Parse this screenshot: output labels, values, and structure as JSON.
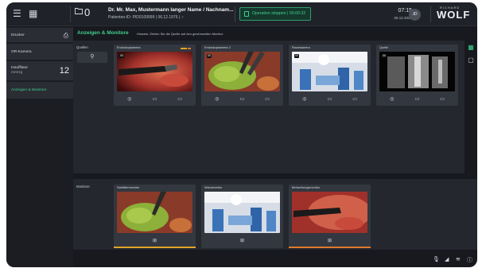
{
  "topbar": {
    "menu_icon": "hamburger-menu-icon",
    "grid_icon": "grid-icon",
    "folder_icon": "folder-icon",
    "folder_count": "0",
    "patient_name": "Dr. Mr. Max, Mustermann langer Name / Nachnam...",
    "patient_id_line": "Patienten-ID: PID0109999 | 06.12.1976 | ♂",
    "op_button": "Operation stoppen | 00:00:32",
    "time": "07:15",
    "date": "06.12.2022",
    "avatar": "JD",
    "brand_small": "RICHARD",
    "brand": "WOLF"
  },
  "sidebar": {
    "items": [
      {
        "label": "Drucker"
      },
      {
        "label": "OR-Kamera"
      },
      {
        "label": "Insufflator",
        "sublabel": "mmHg",
        "value": "12"
      },
      {
        "label": "Anzeigen & Monitore"
      }
    ]
  },
  "content": {
    "title": "Anzeigen & Monitore",
    "hint": "Hinweis: Ziehen Sie die Quelle auf den gewünschten Monitor.",
    "sources_label": "Quellen",
    "monitors_label": "Monitore",
    "sources": [
      {
        "title": "Endoskopkamera",
        "badge": "00"
      },
      {
        "title": "Endoskopkamera 2",
        "badge": "00"
      },
      {
        "title": "Raumkamera",
        "badge": "00"
      },
      {
        "title": "Quelle",
        "badge": "00"
      }
    ],
    "monitors": [
      {
        "title": "Satellitenmonitor"
      },
      {
        "title": "Wandmonitor"
      },
      {
        "title": "Betrachtungsmonitor"
      }
    ]
  },
  "colors": {
    "accent": "#3fd08c",
    "monitor_bar_1": "#e0a526",
    "monitor_bar_3": "#e0792a"
  }
}
